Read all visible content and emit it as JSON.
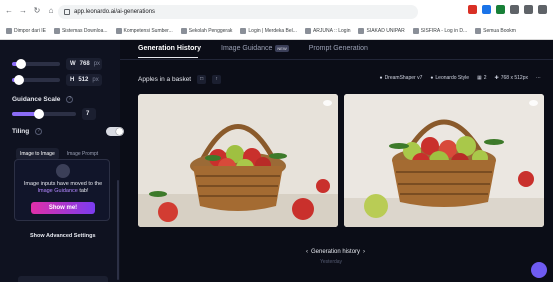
{
  "browser": {
    "url": "app.leonardo.ai/ai-generations",
    "bookmarks": [
      "Dimpor dari IE",
      "Sistemas Downloa...",
      "Kompetensi Sumber...",
      "Sekolah Penggerak",
      "Login | Merdeka Bel...",
      "ARJUNA :: Login",
      "SIAKAD UNIPAR",
      "SISFIRA - Log in D...",
      "Semua Bookm"
    ]
  },
  "sidebar": {
    "width_label": "W",
    "width_value": "768",
    "height_label": "H",
    "height_value": "512",
    "unit": "px",
    "guidance_label": "Guidance Scale",
    "guidance_value": "7",
    "tiling_label": "Tiling",
    "subtabs": [
      "Image to Image",
      "Image Prompt"
    ],
    "card_text_prefix": "Image inputs have moved to the",
    "card_text_highlight": "Image Guidance",
    "card_text_suffix": "tab!",
    "card_button": "Show me!",
    "advanced": "Show Advanced Settings"
  },
  "tabs": [
    {
      "label": "Generation History",
      "active": true
    },
    {
      "label": "Image Guidance",
      "badge": "NEW"
    },
    {
      "label": "Prompt Generation"
    }
  ],
  "prompt": "Apples in a basket",
  "meta": {
    "model": "DreamShaper v7",
    "style": "Leonardo Style",
    "count": "2",
    "size": "768 x 512px"
  },
  "history": {
    "title": "Generation history",
    "sub": "Yesterday"
  },
  "colors": {
    "accent": "#8b6cf6",
    "highlight": "#b388ff",
    "background": "#0b0d17"
  }
}
